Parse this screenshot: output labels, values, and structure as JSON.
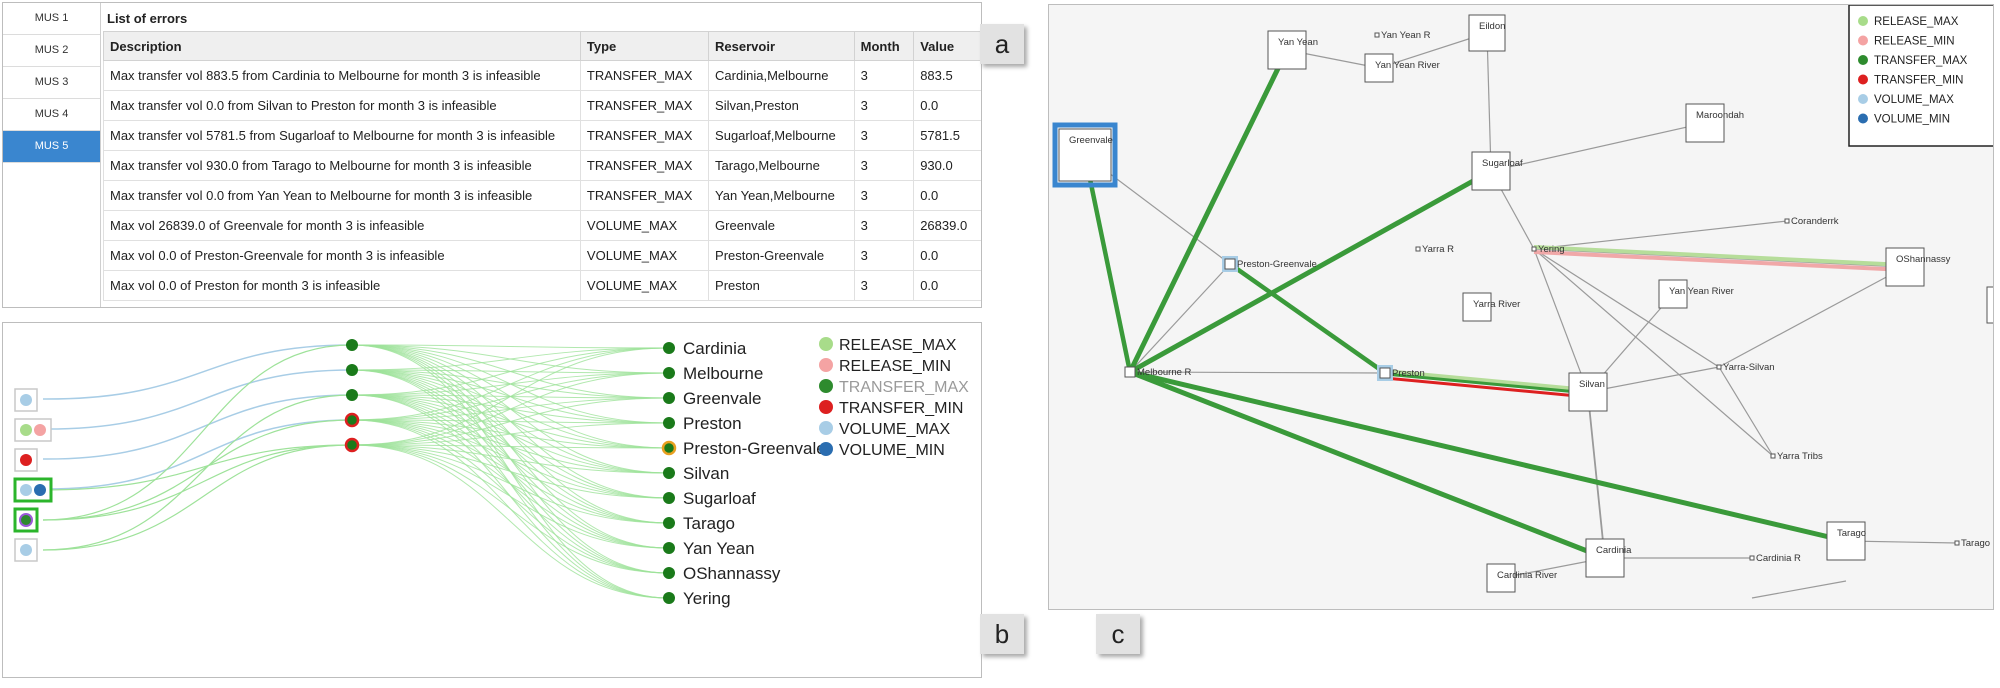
{
  "panel_tags": {
    "a": "a",
    "b": "b",
    "c": "c"
  },
  "mus_tabs": [
    {
      "label": "MUS 1",
      "active": false
    },
    {
      "label": "MUS 2",
      "active": false
    },
    {
      "label": "MUS 3",
      "active": false
    },
    {
      "label": "MUS 4",
      "active": false
    },
    {
      "label": "MUS 5",
      "active": true
    }
  ],
  "errors": {
    "title": "List of errors",
    "headers": [
      "Description",
      "Type",
      "Reservoir",
      "Month",
      "Value"
    ],
    "rows": [
      [
        "Max transfer vol 883.5 from Cardinia to Melbourne for month 3 is infeasible",
        "TRANSFER_MAX",
        "Cardinia,Melbourne",
        "3",
        "883.5"
      ],
      [
        "Max transfer vol 0.0 from Silvan to Preston for month 3 is infeasible",
        "TRANSFER_MAX",
        "Silvan,Preston",
        "3",
        "0.0"
      ],
      [
        "Max transfer vol 5781.5 from Sugarloaf to Melbourne for month 3 is infeasible",
        "TRANSFER_MAX",
        "Sugarloaf,Melbourne",
        "3",
        "5781.5"
      ],
      [
        "Max transfer vol 930.0 from Tarago to Melbourne for month 3 is infeasible",
        "TRANSFER_MAX",
        "Tarago,Melbourne",
        "3",
        "930.0"
      ],
      [
        "Max transfer vol 0.0 from Yan Yean to Melbourne for month 3 is infeasible",
        "TRANSFER_MAX",
        "Yan Yean,Melbourne",
        "3",
        "0.0"
      ],
      [
        "Max vol 26839.0 of Greenvale for month 3 is infeasible",
        "VOLUME_MAX",
        "Greenvale",
        "3",
        "26839.0"
      ],
      [
        "Max vol 0.0 of Preston-Greenvale for month 3 is infeasible",
        "VOLUME_MAX",
        "Preston-Greenvale",
        "3",
        "0.0"
      ],
      [
        "Max vol 0.0 of Preston for month 3 is infeasible",
        "VOLUME_MAX",
        "Preston",
        "3",
        "0.0"
      ]
    ]
  },
  "legend": [
    {
      "label": "RELEASE_MAX",
      "color": "#a8dc8a"
    },
    {
      "label": "RELEASE_MIN",
      "color": "#f4a3a3"
    },
    {
      "label": "TRANSFER_MAX",
      "color": "#2e8b2e"
    },
    {
      "label": "TRANSFER_MIN",
      "color": "#dd2020"
    },
    {
      "label": "VOLUME_MAX",
      "color": "#a8cde6"
    },
    {
      "label": "VOLUME_MIN",
      "color": "#2a6db0"
    }
  ],
  "panel_b": {
    "reservoirs": [
      "Cardinia",
      "Melbourne",
      "Greenvale",
      "Preston",
      "Preston-Greenvale",
      "Silvan",
      "Sugarloaf",
      "Tarago",
      "Yan Yean",
      "OShannassy",
      "Yering"
    ],
    "legend_muted_item": "TRANSFER_MAX",
    "colors": {
      "link_blue": "#a8cde6",
      "link_green": "#9ee29a",
      "node_green": "#1a7a1a",
      "highlight": "#2bb52b",
      "node_red": "#dd2020",
      "node_orange": "#e8a020"
    }
  },
  "panel_c": {
    "nodes": [
      "Yan Yean",
      "Yan Yean R",
      "Yan Yean River",
      "Eildon",
      "Greenvale",
      "Maroondah",
      "Sugarloaf",
      "Coranderrk",
      "Yarra R",
      "Preston-Greenvale",
      "OShannassy",
      "Yering",
      "Yarra River",
      "Yan Yean River",
      "Melbourne R",
      "Preston",
      "Silvan",
      "Yarra-Silvan",
      "Yarra Tribs",
      "Tarago",
      "Tarago R",
      "Cardinia",
      "Cardinia R",
      "Cardinia River"
    ],
    "colors": {
      "edge_grey": "#9a9a9a",
      "edge_green": "#3a9a3a",
      "edge_light_green": "#b6dd9a",
      "edge_pink": "#f0a8a8",
      "edge_red": "#dd2020",
      "node_highlight": "#3a86cf"
    }
  }
}
